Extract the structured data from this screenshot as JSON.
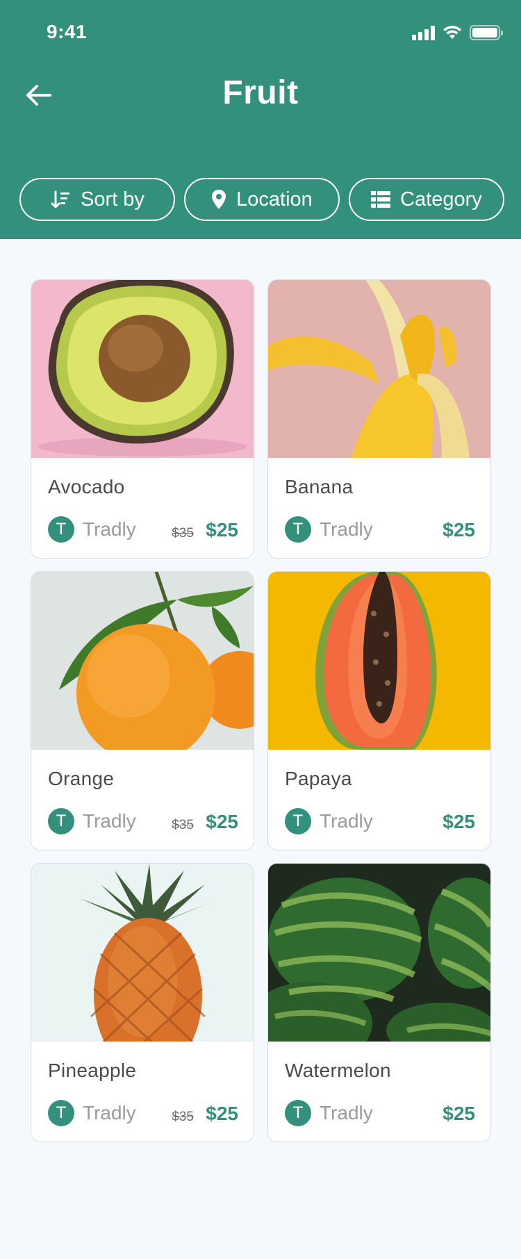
{
  "status_bar": {
    "time": "9:41"
  },
  "header": {
    "title": "Fruit"
  },
  "filters": [
    {
      "label": "Sort by",
      "icon": "sort-icon"
    },
    {
      "label": "Location",
      "icon": "location-pin-icon"
    },
    {
      "label": "Category",
      "icon": "list-grid-icon"
    }
  ],
  "products": [
    {
      "name": "Avocado",
      "seller": "Tradly",
      "seller_initial": "T",
      "old_price": "$35",
      "price": "$25",
      "image": "avocado-image"
    },
    {
      "name": "Banana",
      "seller": "Tradly",
      "seller_initial": "T",
      "old_price": "",
      "price": "$25",
      "image": "banana-image"
    },
    {
      "name": "Orange",
      "seller": "Tradly",
      "seller_initial": "T",
      "old_price": "$35",
      "price": "$25",
      "image": "orange-image"
    },
    {
      "name": "Papaya",
      "seller": "Tradly",
      "seller_initial": "T",
      "old_price": "",
      "price": "$25",
      "image": "papaya-image"
    },
    {
      "name": "Pineapple",
      "seller": "Tradly",
      "seller_initial": "T",
      "old_price": "$35",
      "price": "$25",
      "image": "pineapple-image"
    },
    {
      "name": "Watermelon",
      "seller": "Tradly",
      "seller_initial": "T",
      "old_price": "",
      "price": "$25",
      "image": "watermelon-image"
    }
  ],
  "colors": {
    "brand": "#33907C",
    "background": "#F5F8FD"
  }
}
